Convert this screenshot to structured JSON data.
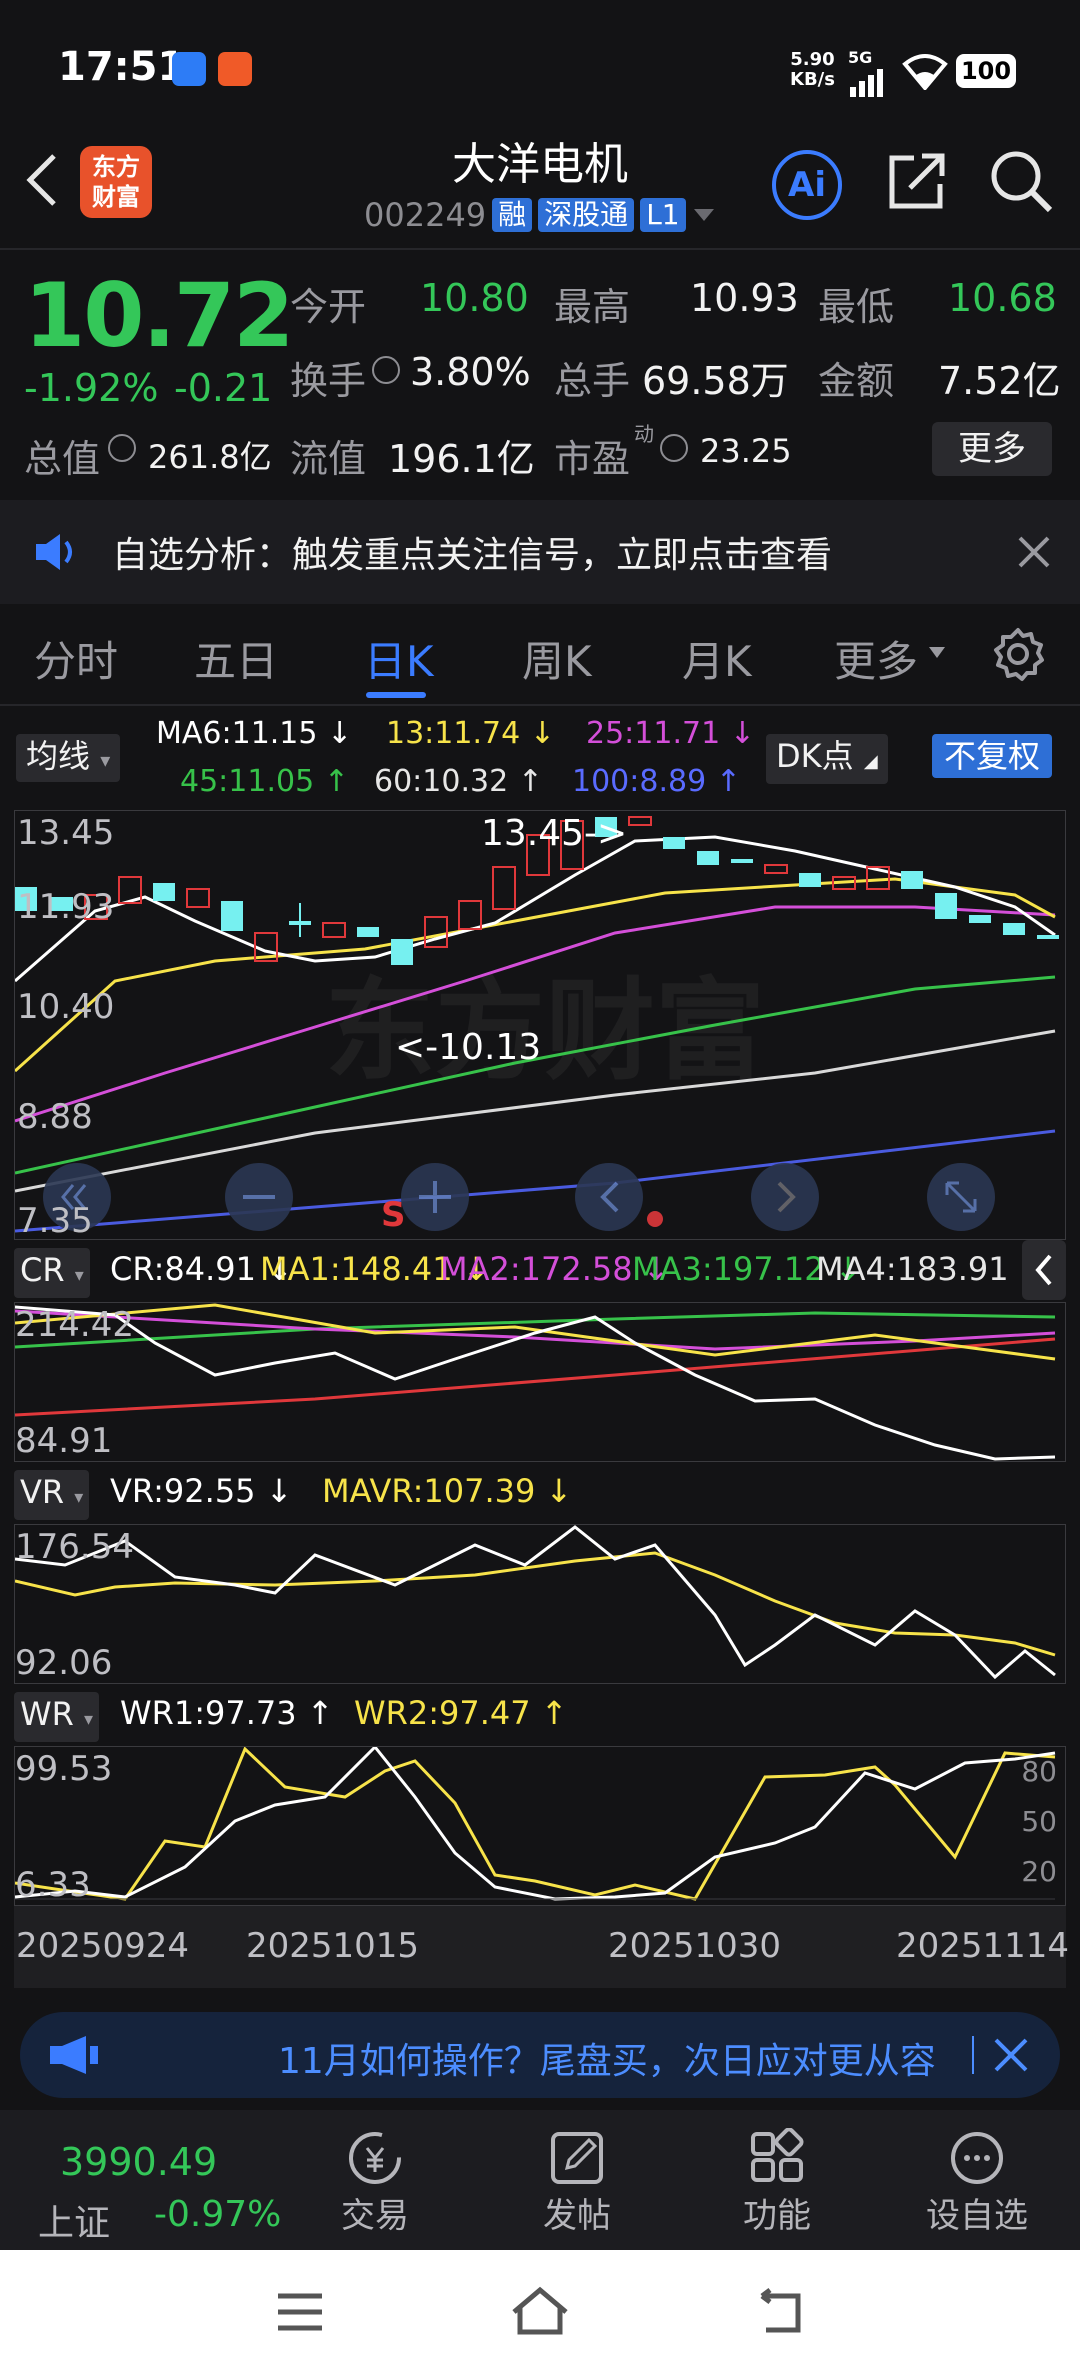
{
  "status_bar": {
    "time": "17:51",
    "net_speed_top": "5.90",
    "net_speed_bottom": "KB/s",
    "signal": "5G",
    "battery": "100"
  },
  "header": {
    "logo_top": "东方",
    "logo_bottom": "财富",
    "title": "大洋电机",
    "code": "002249",
    "tags": [
      "融",
      "深股通",
      "L1"
    ],
    "ai_label": "Ai"
  },
  "quote": {
    "price": "10.72",
    "change_pct": "-1.92%",
    "change": "-0.21",
    "open_label": "今开",
    "open": "10.80",
    "high_label": "最高",
    "high": "10.93",
    "low_label": "最低",
    "low": "10.68",
    "turnover_label": "换手",
    "turnover": "3.80%",
    "volume_label": "总手",
    "volume": "69.58万",
    "amount_label": "金额",
    "amount": "7.52亿",
    "mcap_label": "总值",
    "mcap": "261.8亿",
    "float_label": "流值",
    "float_cap": "196.1亿",
    "pe_label": "市盈",
    "pe_sup": "动",
    "pe": "23.25",
    "more_label": "更多"
  },
  "notice": {
    "text": "自选分析：触发重点关注信号，立即点击查看"
  },
  "tabs": [
    {
      "label": "分时"
    },
    {
      "label": "五日"
    },
    {
      "label": "日K"
    },
    {
      "label": "周K"
    },
    {
      "label": "月K"
    },
    {
      "label": "更多"
    }
  ],
  "active_tab": "日K",
  "kline": {
    "selector": "均线",
    "ma": [
      {
        "text": "MA6:11.15 ↓",
        "color": "#ffffff"
      },
      {
        "text": "13:11.74 ↓",
        "color": "#f7e34a"
      },
      {
        "text": "25:11.71 ↓",
        "color": "#d44fd9"
      },
      {
        "text": "45:11.05 ↑",
        "color": "#37c24a"
      },
      {
        "text": "60:10.32 ↑",
        "color": "#e6e6e6"
      },
      {
        "text": "100:8.89 ↑",
        "color": "#5a6bff"
      }
    ],
    "dk_label": "DK点",
    "adjust_label": "不复权",
    "y_labels": [
      "13.45",
      "11.93",
      "10.40",
      "8.88",
      "7.35"
    ],
    "high_annot": "13.45->",
    "low_annot": "<-10.13",
    "signal_mark": "S",
    "watermark": "东方财富"
  },
  "cr": {
    "name": "CR",
    "values": [
      {
        "text": "CR:84.91 ↓",
        "color": "#ffffff"
      },
      {
        "text": "MA1:148.41 ↓",
        "color": "#f7e34a"
      },
      {
        "text": "MA2:172.58 ↓",
        "color": "#d44fd9"
      },
      {
        "text": "MA3:197.12 ↓",
        "color": "#37c24a"
      },
      {
        "text": "MA4:183.91 ↑",
        "color": "#e6e6e6"
      }
    ],
    "y_labels": [
      "214.42",
      "84.91"
    ]
  },
  "vr": {
    "name": "VR",
    "values": [
      {
        "text": "VR:92.55 ↓",
        "color": "#ffffff"
      },
      {
        "text": "MAVR:107.39 ↓",
        "color": "#f7e34a"
      }
    ],
    "y_labels": [
      "176.54",
      "92.06"
    ]
  },
  "wr": {
    "name": "WR",
    "values": [
      {
        "text": "WR1:97.73 ↑",
        "color": "#ffffff"
      },
      {
        "text": "WR2:97.47 ↑",
        "color": "#f7e34a"
      }
    ],
    "y_labels": [
      "99.53",
      "6.33"
    ],
    "ref_levels": [
      "80",
      "50",
      "20"
    ]
  },
  "dates": [
    "20250924",
    "20251015",
    "20251030",
    "20251114"
  ],
  "promo": {
    "text": "11月如何操作？尾盘买，次日应对更从容"
  },
  "bottom_nav": {
    "index_value": "3990.49",
    "index_name": "上证",
    "index_change": "-0.97%",
    "items": [
      {
        "label": "交易"
      },
      {
        "label": "发帖"
      },
      {
        "label": "功能"
      },
      {
        "label": "设自选"
      }
    ]
  }
}
